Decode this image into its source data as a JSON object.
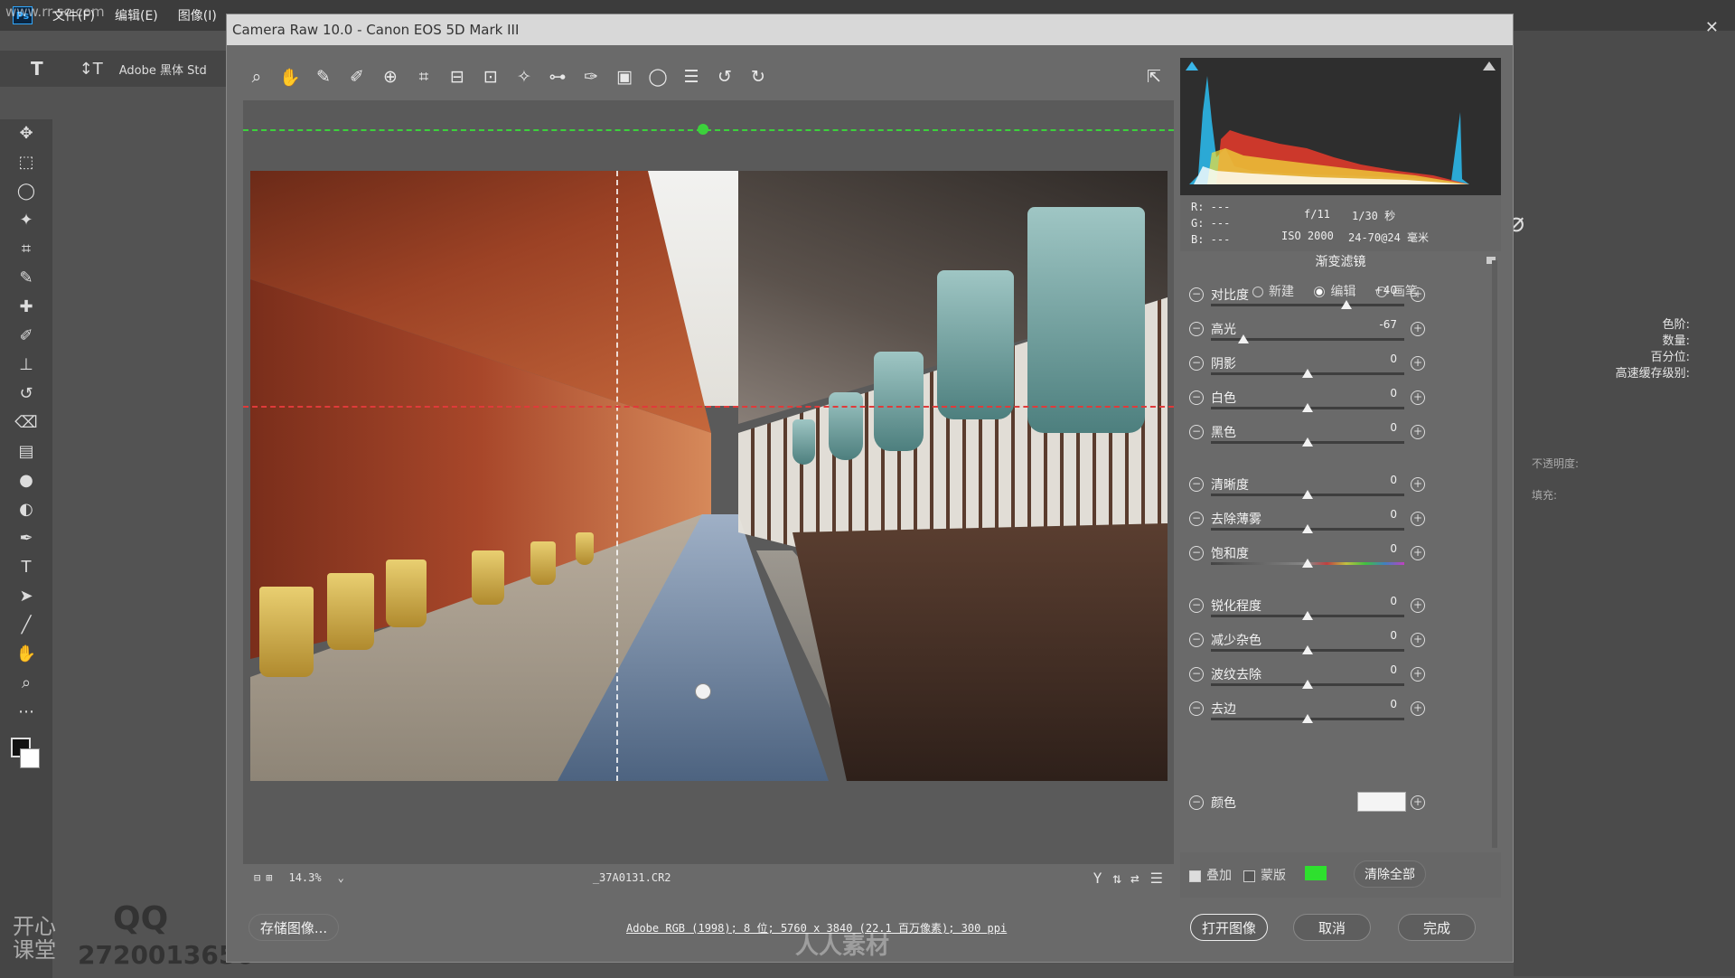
{
  "watermark_site": "www.rr-sc.com",
  "ps": {
    "menus": [
      "文件(F)",
      "编辑(E)",
      "图像(I)"
    ],
    "font_name": "Adobe 黑体 Std",
    "right_labels": [
      "色阶:",
      "数量:",
      "百分位:",
      "高速缓存级别:"
    ],
    "opacity_label": "不透明度:",
    "fill_label": "填充:"
  },
  "acr": {
    "title": "Camera Raw 10.0 -  Canon EOS 5D Mark III",
    "zoom": "14.3%",
    "filename": "_37A0131.CR2",
    "workflow_link": "Adobe RGB (1998); 8 位; 5760 x 3840 (22.1 百万像素); 300 ppi",
    "save_button": "存储图像...",
    "open_button": "打开图像",
    "cancel_button": "取消",
    "done_button": "完成"
  },
  "readout": {
    "r": "R:  ---",
    "g": "G:  ---",
    "b": "B:  ---",
    "aperture": "f/11",
    "shutter": "1/30 秒",
    "iso": "ISO 2000",
    "lens": "24-70@24 毫米"
  },
  "panel": {
    "title": "渐变滤镜",
    "modes": [
      "新建",
      "编辑",
      "画笔"
    ],
    "selected_mode": "编辑",
    "sliders": [
      {
        "name": "对比度",
        "value": "+40",
        "level": 0.7
      },
      {
        "name": "高光",
        "value": "-67",
        "level": 0.17
      },
      {
        "name": "阴影",
        "value": "0",
        "level": 0.5
      },
      {
        "name": "白色",
        "value": "0",
        "level": 0.5
      },
      {
        "name": "黑色",
        "value": "0",
        "level": 0.5
      },
      {
        "name": "清晰度",
        "value": "0",
        "level": 0.5
      },
      {
        "name": "去除薄雾",
        "value": "0",
        "level": 0.5
      },
      {
        "name": "饱和度",
        "value": "0",
        "level": 0.5
      },
      {
        "name": "锐化程度",
        "value": "0",
        "level": 0.5
      },
      {
        "name": "减少杂色",
        "value": "0",
        "level": 0.5
      },
      {
        "name": "波纹去除",
        "value": "0",
        "level": 0.5
      },
      {
        "name": "去边",
        "value": "0",
        "level": 0.5
      }
    ],
    "color_label": "颜色",
    "overlay_label": "叠加",
    "mask_label": "蒙版",
    "mask_color": "#2ee02e",
    "clear_all": "清除全部"
  },
  "guide_colors": {
    "top": "#3cd13c",
    "bottom": "#e03a3a"
  }
}
